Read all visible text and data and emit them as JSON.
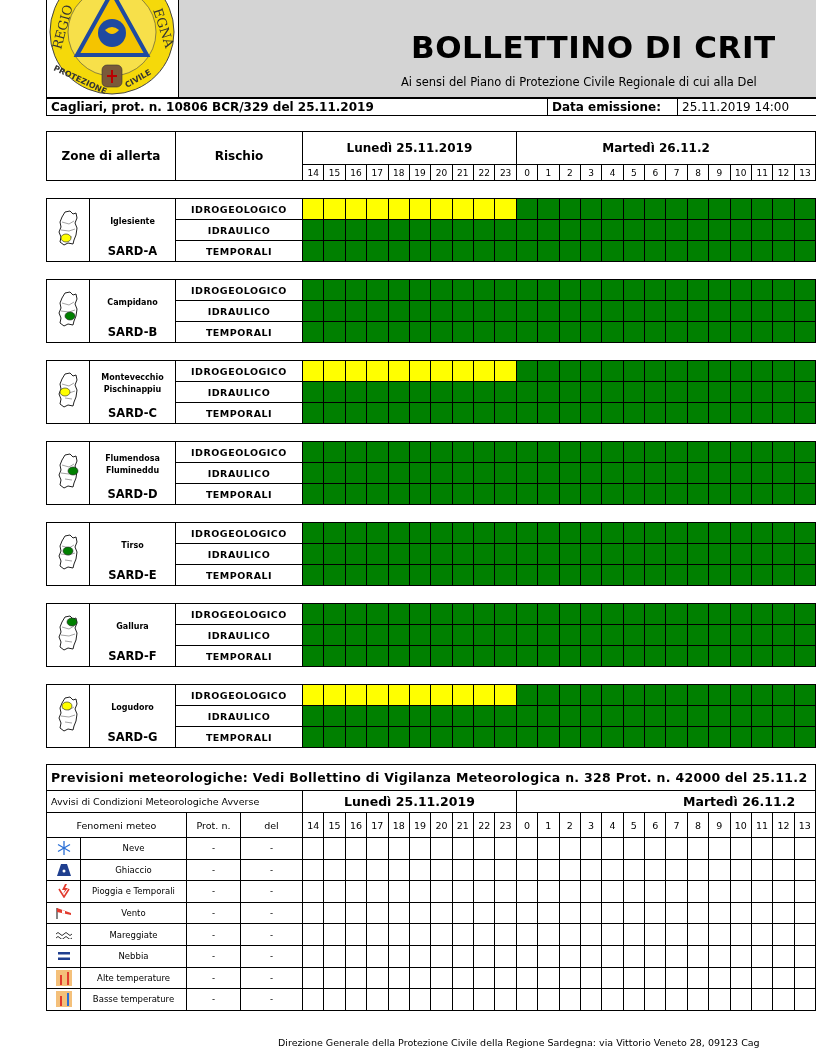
{
  "header": {
    "logo": {
      "top_left": "REGIO",
      "top_right": "EGNA",
      "bottom_left": "PROTEZIONE",
      "bottom_right": "CIVILE"
    },
    "title": "BOLLETTINO DI CRIT",
    "subtitle": "Ai sensi del Piano di Protezione Civile Regionale di cui alla Del",
    "protocol": "Cagliari, prot. n. 10806 BCR/329 del 25.11.2019",
    "issue_label": "Data emissione:",
    "issue_value": "25.11.2019 14:00"
  },
  "alert_table": {
    "zone_heading": "Zone di allerta",
    "risk_heading": "Rischio",
    "days": [
      {
        "label": "Lunedì 25.11.2019",
        "hours": [
          "14",
          "15",
          "16",
          "17",
          "18",
          "19",
          "20",
          "21",
          "22",
          "23"
        ]
      },
      {
        "label": "Martedì 26.11.2",
        "hours": [
          "0",
          "1",
          "2",
          "3",
          "4",
          "5",
          "6",
          "7",
          "8",
          "9",
          "10",
          "11",
          "12",
          "13"
        ]
      }
    ]
  },
  "zones": [
    {
      "name": "Iglesiente",
      "code": "SARD-A",
      "color": "#ffff00",
      "risks": [
        {
          "name": "IDROGEOLOGICO",
          "cells": [
            {
              "color": "#ffff00"
            },
            {
              "color": "#ffff00"
            },
            {
              "color": "#ffff00"
            },
            {
              "color": "#ffff00"
            },
            {
              "color": "#ffff00"
            },
            {
              "color": "#ffff00"
            },
            {
              "color": "#ffff00"
            },
            {
              "color": "#ffff00"
            },
            {
              "color": "#ffff00"
            },
            {
              "color": "#ffff00"
            },
            {
              "color": "#008000"
            },
            {
              "color": "#008000"
            },
            {
              "color": "#008000"
            },
            {
              "color": "#008000"
            },
            {
              "color": "#008000"
            },
            {
              "color": "#008000"
            },
            {
              "color": "#008000"
            },
            {
              "color": "#008000"
            },
            {
              "color": "#008000"
            },
            {
              "color": "#008000"
            },
            {
              "color": "#008000"
            },
            {
              "color": "#008000"
            },
            {
              "color": "#008000"
            },
            {
              "color": "#008000"
            }
          ]
        },
        {
          "name": "IDRAULICO",
          "cells": [
            {
              "color": "#008000"
            },
            {
              "color": "#008000"
            },
            {
              "color": "#008000"
            },
            {
              "color": "#008000"
            },
            {
              "color": "#008000"
            },
            {
              "color": "#008000"
            },
            {
              "color": "#008000"
            },
            {
              "color": "#008000"
            },
            {
              "color": "#008000"
            },
            {
              "color": "#008000"
            },
            {
              "color": "#008000"
            },
            {
              "color": "#008000"
            },
            {
              "color": "#008000"
            },
            {
              "color": "#008000"
            },
            {
              "color": "#008000"
            },
            {
              "color": "#008000"
            },
            {
              "color": "#008000"
            },
            {
              "color": "#008000"
            },
            {
              "color": "#008000"
            },
            {
              "color": "#008000"
            },
            {
              "color": "#008000"
            },
            {
              "color": "#008000"
            },
            {
              "color": "#008000"
            },
            {
              "color": "#008000"
            }
          ]
        },
        {
          "name": "TEMPORALI",
          "cells": [
            {
              "color": "#008000"
            },
            {
              "color": "#008000"
            },
            {
              "color": "#008000"
            },
            {
              "color": "#008000"
            },
            {
              "color": "#008000"
            },
            {
              "color": "#008000"
            },
            {
              "color": "#008000"
            },
            {
              "color": "#008000"
            },
            {
              "color": "#008000"
            },
            {
              "color": "#008000"
            },
            {
              "color": "#008000"
            },
            {
              "color": "#008000"
            },
            {
              "color": "#008000"
            },
            {
              "color": "#008000"
            },
            {
              "color": "#008000"
            },
            {
              "color": "#008000"
            },
            {
              "color": "#008000"
            },
            {
              "color": "#008000"
            },
            {
              "color": "#008000"
            },
            {
              "color": "#008000"
            },
            {
              "color": "#008000"
            },
            {
              "color": "#008000"
            },
            {
              "color": "#008000"
            },
            {
              "color": "#008000"
            }
          ]
        }
      ]
    },
    {
      "name": "Campidano",
      "code": "SARD-B",
      "color": "#008000",
      "risks": [
        {
          "name": "IDROGEOLOGICO",
          "cells": [
            {
              "color": "#008000"
            },
            {
              "color": "#008000"
            },
            {
              "color": "#008000"
            },
            {
              "color": "#008000"
            },
            {
              "color": "#008000"
            },
            {
              "color": "#008000"
            },
            {
              "color": "#008000"
            },
            {
              "color": "#008000"
            },
            {
              "color": "#008000"
            },
            {
              "color": "#008000"
            },
            {
              "color": "#008000"
            },
            {
              "color": "#008000"
            },
            {
              "color": "#008000"
            },
            {
              "color": "#008000"
            },
            {
              "color": "#008000"
            },
            {
              "color": "#008000"
            },
            {
              "color": "#008000"
            },
            {
              "color": "#008000"
            },
            {
              "color": "#008000"
            },
            {
              "color": "#008000"
            },
            {
              "color": "#008000"
            },
            {
              "color": "#008000"
            },
            {
              "color": "#008000"
            },
            {
              "color": "#008000"
            }
          ]
        },
        {
          "name": "IDRAULICO",
          "cells": [
            {
              "color": "#008000"
            },
            {
              "color": "#008000"
            },
            {
              "color": "#008000"
            },
            {
              "color": "#008000"
            },
            {
              "color": "#008000"
            },
            {
              "color": "#008000"
            },
            {
              "color": "#008000"
            },
            {
              "color": "#008000"
            },
            {
              "color": "#008000"
            },
            {
              "color": "#008000"
            },
            {
              "color": "#008000"
            },
            {
              "color": "#008000"
            },
            {
              "color": "#008000"
            },
            {
              "color": "#008000"
            },
            {
              "color": "#008000"
            },
            {
              "color": "#008000"
            },
            {
              "color": "#008000"
            },
            {
              "color": "#008000"
            },
            {
              "color": "#008000"
            },
            {
              "color": "#008000"
            },
            {
              "color": "#008000"
            },
            {
              "color": "#008000"
            },
            {
              "color": "#008000"
            },
            {
              "color": "#008000"
            }
          ]
        },
        {
          "name": "TEMPORALI",
          "cells": [
            {
              "color": "#008000"
            },
            {
              "color": "#008000"
            },
            {
              "color": "#008000"
            },
            {
              "color": "#008000"
            },
            {
              "color": "#008000"
            },
            {
              "color": "#008000"
            },
            {
              "color": "#008000"
            },
            {
              "color": "#008000"
            },
            {
              "color": "#008000"
            },
            {
              "color": "#008000"
            },
            {
              "color": "#008000"
            },
            {
              "color": "#008000"
            },
            {
              "color": "#008000"
            },
            {
              "color": "#008000"
            },
            {
              "color": "#008000"
            },
            {
              "color": "#008000"
            },
            {
              "color": "#008000"
            },
            {
              "color": "#008000"
            },
            {
              "color": "#008000"
            },
            {
              "color": "#008000"
            },
            {
              "color": "#008000"
            },
            {
              "color": "#008000"
            },
            {
              "color": "#008000"
            },
            {
              "color": "#008000"
            }
          ]
        }
      ]
    },
    {
      "name": "Montevecchio Pischinappiu",
      "code": "SARD-C",
      "color": "#ffff00",
      "risks": [
        {
          "name": "IDROGEOLOGICO",
          "cells": [
            {
              "color": "#ffff00"
            },
            {
              "color": "#ffff00"
            },
            {
              "color": "#ffff00"
            },
            {
              "color": "#ffff00"
            },
            {
              "color": "#ffff00"
            },
            {
              "color": "#ffff00"
            },
            {
              "color": "#ffff00"
            },
            {
              "color": "#ffff00"
            },
            {
              "color": "#ffff00"
            },
            {
              "color": "#ffff00"
            },
            {
              "color": "#008000"
            },
            {
              "color": "#008000"
            },
            {
              "color": "#008000"
            },
            {
              "color": "#008000"
            },
            {
              "color": "#008000"
            },
            {
              "color": "#008000"
            },
            {
              "color": "#008000"
            },
            {
              "color": "#008000"
            },
            {
              "color": "#008000"
            },
            {
              "color": "#008000"
            },
            {
              "color": "#008000"
            },
            {
              "color": "#008000"
            },
            {
              "color": "#008000"
            },
            {
              "color": "#008000"
            }
          ]
        },
        {
          "name": "IDRAULICO",
          "cells": [
            {
              "color": "#008000"
            },
            {
              "color": "#008000"
            },
            {
              "color": "#008000"
            },
            {
              "color": "#008000"
            },
            {
              "color": "#008000"
            },
            {
              "color": "#008000"
            },
            {
              "color": "#008000"
            },
            {
              "color": "#008000"
            },
            {
              "color": "#008000"
            },
            {
              "color": "#008000"
            },
            {
              "color": "#008000"
            },
            {
              "color": "#008000"
            },
            {
              "color": "#008000"
            },
            {
              "color": "#008000"
            },
            {
              "color": "#008000"
            },
            {
              "color": "#008000"
            },
            {
              "color": "#008000"
            },
            {
              "color": "#008000"
            },
            {
              "color": "#008000"
            },
            {
              "color": "#008000"
            },
            {
              "color": "#008000"
            },
            {
              "color": "#008000"
            },
            {
              "color": "#008000"
            },
            {
              "color": "#008000"
            }
          ]
        },
        {
          "name": "TEMPORALI",
          "cells": [
            {
              "color": "#008000"
            },
            {
              "color": "#008000"
            },
            {
              "color": "#008000"
            },
            {
              "color": "#008000"
            },
            {
              "color": "#008000"
            },
            {
              "color": "#008000"
            },
            {
              "color": "#008000"
            },
            {
              "color": "#008000"
            },
            {
              "color": "#008000"
            },
            {
              "color": "#008000"
            },
            {
              "color": "#008000"
            },
            {
              "color": "#008000"
            },
            {
              "color": "#008000"
            },
            {
              "color": "#008000"
            },
            {
              "color": "#008000"
            },
            {
              "color": "#008000"
            },
            {
              "color": "#008000"
            },
            {
              "color": "#008000"
            },
            {
              "color": "#008000"
            },
            {
              "color": "#008000"
            },
            {
              "color": "#008000"
            },
            {
              "color": "#008000"
            },
            {
              "color": "#008000"
            },
            {
              "color": "#008000"
            }
          ]
        }
      ]
    },
    {
      "name": "Flumendosa Flumineddu",
      "code": "SARD-D",
      "color": "#008000",
      "risks": [
        {
          "name": "IDROGEOLOGICO",
          "cells": [
            {
              "color": "#008000"
            },
            {
              "color": "#008000"
            },
            {
              "color": "#008000"
            },
            {
              "color": "#008000"
            },
            {
              "color": "#008000"
            },
            {
              "color": "#008000"
            },
            {
              "color": "#008000"
            },
            {
              "color": "#008000"
            },
            {
              "color": "#008000"
            },
            {
              "color": "#008000"
            },
            {
              "color": "#008000"
            },
            {
              "color": "#008000"
            },
            {
              "color": "#008000"
            },
            {
              "color": "#008000"
            },
            {
              "color": "#008000"
            },
            {
              "color": "#008000"
            },
            {
              "color": "#008000"
            },
            {
              "color": "#008000"
            },
            {
              "color": "#008000"
            },
            {
              "color": "#008000"
            },
            {
              "color": "#008000"
            },
            {
              "color": "#008000"
            },
            {
              "color": "#008000"
            },
            {
              "color": "#008000"
            }
          ]
        },
        {
          "name": "IDRAULICO",
          "cells": [
            {
              "color": "#008000"
            },
            {
              "color": "#008000"
            },
            {
              "color": "#008000"
            },
            {
              "color": "#008000"
            },
            {
              "color": "#008000"
            },
            {
              "color": "#008000"
            },
            {
              "color": "#008000"
            },
            {
              "color": "#008000"
            },
            {
              "color": "#008000"
            },
            {
              "color": "#008000"
            },
            {
              "color": "#008000"
            },
            {
              "color": "#008000"
            },
            {
              "color": "#008000"
            },
            {
              "color": "#008000"
            },
            {
              "color": "#008000"
            },
            {
              "color": "#008000"
            },
            {
              "color": "#008000"
            },
            {
              "color": "#008000"
            },
            {
              "color": "#008000"
            },
            {
              "color": "#008000"
            },
            {
              "color": "#008000"
            },
            {
              "color": "#008000"
            },
            {
              "color": "#008000"
            },
            {
              "color": "#008000"
            }
          ]
        },
        {
          "name": "TEMPORALI",
          "cells": [
            {
              "color": "#008000"
            },
            {
              "color": "#008000"
            },
            {
              "color": "#008000"
            },
            {
              "color": "#008000"
            },
            {
              "color": "#008000"
            },
            {
              "color": "#008000"
            },
            {
              "color": "#008000"
            },
            {
              "color": "#008000"
            },
            {
              "color": "#008000"
            },
            {
              "color": "#008000"
            },
            {
              "color": "#008000"
            },
            {
              "color": "#008000"
            },
            {
              "color": "#008000"
            },
            {
              "color": "#008000"
            },
            {
              "color": "#008000"
            },
            {
              "color": "#008000"
            },
            {
              "color": "#008000"
            },
            {
              "color": "#008000"
            },
            {
              "color": "#008000"
            },
            {
              "color": "#008000"
            },
            {
              "color": "#008000"
            },
            {
              "color": "#008000"
            },
            {
              "color": "#008000"
            },
            {
              "color": "#008000"
            }
          ]
        }
      ]
    },
    {
      "name": "Tirso",
      "code": "SARD-E",
      "color": "#008000",
      "risks": [
        {
          "name": "IDROGEOLOGICO",
          "cells": [
            {
              "color": "#008000"
            },
            {
              "color": "#008000"
            },
            {
              "color": "#008000"
            },
            {
              "color": "#008000"
            },
            {
              "color": "#008000"
            },
            {
              "color": "#008000"
            },
            {
              "color": "#008000"
            },
            {
              "color": "#008000"
            },
            {
              "color": "#008000"
            },
            {
              "color": "#008000"
            },
            {
              "color": "#008000"
            },
            {
              "color": "#008000"
            },
            {
              "color": "#008000"
            },
            {
              "color": "#008000"
            },
            {
              "color": "#008000"
            },
            {
              "color": "#008000"
            },
            {
              "color": "#008000"
            },
            {
              "color": "#008000"
            },
            {
              "color": "#008000"
            },
            {
              "color": "#008000"
            },
            {
              "color": "#008000"
            },
            {
              "color": "#008000"
            },
            {
              "color": "#008000"
            },
            {
              "color": "#008000"
            }
          ]
        },
        {
          "name": "IDRAULICO",
          "cells": [
            {
              "color": "#008000"
            },
            {
              "color": "#008000"
            },
            {
              "color": "#008000"
            },
            {
              "color": "#008000"
            },
            {
              "color": "#008000"
            },
            {
              "color": "#008000"
            },
            {
              "color": "#008000"
            },
            {
              "color": "#008000"
            },
            {
              "color": "#008000"
            },
            {
              "color": "#008000"
            },
            {
              "color": "#008000"
            },
            {
              "color": "#008000"
            },
            {
              "color": "#008000"
            },
            {
              "color": "#008000"
            },
            {
              "color": "#008000"
            },
            {
              "color": "#008000"
            },
            {
              "color": "#008000"
            },
            {
              "color": "#008000"
            },
            {
              "color": "#008000"
            },
            {
              "color": "#008000"
            },
            {
              "color": "#008000"
            },
            {
              "color": "#008000"
            },
            {
              "color": "#008000"
            },
            {
              "color": "#008000"
            }
          ]
        },
        {
          "name": "TEMPORALI",
          "cells": [
            {
              "color": "#008000"
            },
            {
              "color": "#008000"
            },
            {
              "color": "#008000"
            },
            {
              "color": "#008000"
            },
            {
              "color": "#008000"
            },
            {
              "color": "#008000"
            },
            {
              "color": "#008000"
            },
            {
              "color": "#008000"
            },
            {
              "color": "#008000"
            },
            {
              "color": "#008000"
            },
            {
              "color": "#008000"
            },
            {
              "color": "#008000"
            },
            {
              "color": "#008000"
            },
            {
              "color": "#008000"
            },
            {
              "color": "#008000"
            },
            {
              "color": "#008000"
            },
            {
              "color": "#008000"
            },
            {
              "color": "#008000"
            },
            {
              "color": "#008000"
            },
            {
              "color": "#008000"
            },
            {
              "color": "#008000"
            },
            {
              "color": "#008000"
            },
            {
              "color": "#008000"
            },
            {
              "color": "#008000"
            }
          ]
        }
      ]
    },
    {
      "name": "Gallura",
      "code": "SARD-F",
      "color": "#008000",
      "risks": [
        {
          "name": "IDROGEOLOGICO",
          "cells": [
            {
              "color": "#008000"
            },
            {
              "color": "#008000"
            },
            {
              "color": "#008000"
            },
            {
              "color": "#008000"
            },
            {
              "color": "#008000"
            },
            {
              "color": "#008000"
            },
            {
              "color": "#008000"
            },
            {
              "color": "#008000"
            },
            {
              "color": "#008000"
            },
            {
              "color": "#008000"
            },
            {
              "color": "#008000"
            },
            {
              "color": "#008000"
            },
            {
              "color": "#008000"
            },
            {
              "color": "#008000"
            },
            {
              "color": "#008000"
            },
            {
              "color": "#008000"
            },
            {
              "color": "#008000"
            },
            {
              "color": "#008000"
            },
            {
              "color": "#008000"
            },
            {
              "color": "#008000"
            },
            {
              "color": "#008000"
            },
            {
              "color": "#008000"
            },
            {
              "color": "#008000"
            },
            {
              "color": "#008000"
            }
          ]
        },
        {
          "name": "IDRAULICO",
          "cells": [
            {
              "color": "#008000"
            },
            {
              "color": "#008000"
            },
            {
              "color": "#008000"
            },
            {
              "color": "#008000"
            },
            {
              "color": "#008000"
            },
            {
              "color": "#008000"
            },
            {
              "color": "#008000"
            },
            {
              "color": "#008000"
            },
            {
              "color": "#008000"
            },
            {
              "color": "#008000"
            },
            {
              "color": "#008000"
            },
            {
              "color": "#008000"
            },
            {
              "color": "#008000"
            },
            {
              "color": "#008000"
            },
            {
              "color": "#008000"
            },
            {
              "color": "#008000"
            },
            {
              "color": "#008000"
            },
            {
              "color": "#008000"
            },
            {
              "color": "#008000"
            },
            {
              "color": "#008000"
            },
            {
              "color": "#008000"
            },
            {
              "color": "#008000"
            },
            {
              "color": "#008000"
            },
            {
              "color": "#008000"
            }
          ]
        },
        {
          "name": "TEMPORALI",
          "cells": [
            {
              "color": "#008000"
            },
            {
              "color": "#008000"
            },
            {
              "color": "#008000"
            },
            {
              "color": "#008000"
            },
            {
              "color": "#008000"
            },
            {
              "color": "#008000"
            },
            {
              "color": "#008000"
            },
            {
              "color": "#008000"
            },
            {
              "color": "#008000"
            },
            {
              "color": "#008000"
            },
            {
              "color": "#008000"
            },
            {
              "color": "#008000"
            },
            {
              "color": "#008000"
            },
            {
              "color": "#008000"
            },
            {
              "color": "#008000"
            },
            {
              "color": "#008000"
            },
            {
              "color": "#008000"
            },
            {
              "color": "#008000"
            },
            {
              "color": "#008000"
            },
            {
              "color": "#008000"
            },
            {
              "color": "#008000"
            },
            {
              "color": "#008000"
            },
            {
              "color": "#008000"
            },
            {
              "color": "#008000"
            }
          ]
        }
      ]
    },
    {
      "name": "Logudoro",
      "code": "SARD-G",
      "color": "#ffff00",
      "risks": [
        {
          "name": "IDROGEOLOGICO",
          "cells": [
            {
              "color": "#ffff00"
            },
            {
              "color": "#ffff00"
            },
            {
              "color": "#ffff00"
            },
            {
              "color": "#ffff00"
            },
            {
              "color": "#ffff00"
            },
            {
              "color": "#ffff00"
            },
            {
              "color": "#ffff00"
            },
            {
              "color": "#ffff00"
            },
            {
              "color": "#ffff00"
            },
            {
              "color": "#ffff00"
            },
            {
              "color": "#008000"
            },
            {
              "color": "#008000"
            },
            {
              "color": "#008000"
            },
            {
              "color": "#008000"
            },
            {
              "color": "#008000"
            },
            {
              "color": "#008000"
            },
            {
              "color": "#008000"
            },
            {
              "color": "#008000"
            },
            {
              "color": "#008000"
            },
            {
              "color": "#008000"
            },
            {
              "color": "#008000"
            },
            {
              "color": "#008000"
            },
            {
              "color": "#008000"
            },
            {
              "color": "#008000"
            }
          ]
        },
        {
          "name": "IDRAULICO",
          "cells": [
            {
              "color": "#008000"
            },
            {
              "color": "#008000"
            },
            {
              "color": "#008000"
            },
            {
              "color": "#008000"
            },
            {
              "color": "#008000"
            },
            {
              "color": "#008000"
            },
            {
              "color": "#008000"
            },
            {
              "color": "#008000"
            },
            {
              "color": "#008000"
            },
            {
              "color": "#008000"
            },
            {
              "color": "#008000"
            },
            {
              "color": "#008000"
            },
            {
              "color": "#008000"
            },
            {
              "color": "#008000"
            },
            {
              "color": "#008000"
            },
            {
              "color": "#008000"
            },
            {
              "color": "#008000"
            },
            {
              "color": "#008000"
            },
            {
              "color": "#008000"
            },
            {
              "color": "#008000"
            },
            {
              "color": "#008000"
            },
            {
              "color": "#008000"
            },
            {
              "color": "#008000"
            },
            {
              "color": "#008000"
            }
          ]
        },
        {
          "name": "TEMPORALI",
          "cells": [
            {
              "color": "#008000"
            },
            {
              "color": "#008000"
            },
            {
              "color": "#008000"
            },
            {
              "color": "#008000"
            },
            {
              "color": "#008000"
            },
            {
              "color": "#008000"
            },
            {
              "color": "#008000"
            },
            {
              "color": "#008000"
            },
            {
              "color": "#008000"
            },
            {
              "color": "#008000"
            },
            {
              "color": "#008000"
            },
            {
              "color": "#008000"
            },
            {
              "color": "#008000"
            },
            {
              "color": "#008000"
            },
            {
              "color": "#008000"
            },
            {
              "color": "#008000"
            },
            {
              "color": "#008000"
            },
            {
              "color": "#008000"
            },
            {
              "color": "#008000"
            },
            {
              "color": "#008000"
            },
            {
              "color": "#008000"
            },
            {
              "color": "#008000"
            },
            {
              "color": "#008000"
            },
            {
              "color": "#008000"
            }
          ]
        }
      ]
    }
  ],
  "weather": {
    "title": "Previsioni meteorologiche: Vedi Bollettino di Vigilanza Meteorologica n. 328 Prot. n. 42000 del 25.11.2",
    "warnings_heading": "Avvisi di Condizioni Meteorologiche Avverse",
    "phenomena_heading": "Fenomeni meteo",
    "prot_heading": "Prot. n.",
    "date_heading": "del",
    "days": [
      {
        "label": "Lunedì 25.11.2019",
        "hours": [
          "14",
          "15",
          "16",
          "17",
          "18",
          "19",
          "20",
          "21",
          "22",
          "23"
        ]
      },
      {
        "label": "Martedì 26.11.2",
        "hours": [
          "0",
          "1",
          "2",
          "3",
          "4",
          "5",
          "6",
          "7",
          "8",
          "9",
          "10",
          "11",
          "12",
          "13"
        ]
      }
    ],
    "rows": [
      {
        "kind": "snow",
        "name": "Neve",
        "prot": "-",
        "date": "-"
      },
      {
        "kind": "ice",
        "name": "Ghiaccio",
        "prot": "-",
        "date": "-"
      },
      {
        "kind": "rain",
        "name": "Pioggia e Temporali",
        "prot": "-",
        "date": "-"
      },
      {
        "kind": "wind",
        "name": "Vento",
        "prot": "-",
        "date": "-"
      },
      {
        "kind": "waves",
        "name": "Mareggiate",
        "prot": "-",
        "date": "-"
      },
      {
        "kind": "fog",
        "name": "Nebbia",
        "prot": "-",
        "date": "-"
      },
      {
        "kind": "heat",
        "name": "Alte temperature",
        "prot": "-",
        "date": "-"
      },
      {
        "kind": "cold",
        "name": "Basse temperature",
        "prot": "-",
        "date": "-"
      }
    ]
  },
  "footer": "Direzione Generale della Protezione Civile della Regione Sardegna: via Vittorio Veneto 28, 09123 Cag"
}
